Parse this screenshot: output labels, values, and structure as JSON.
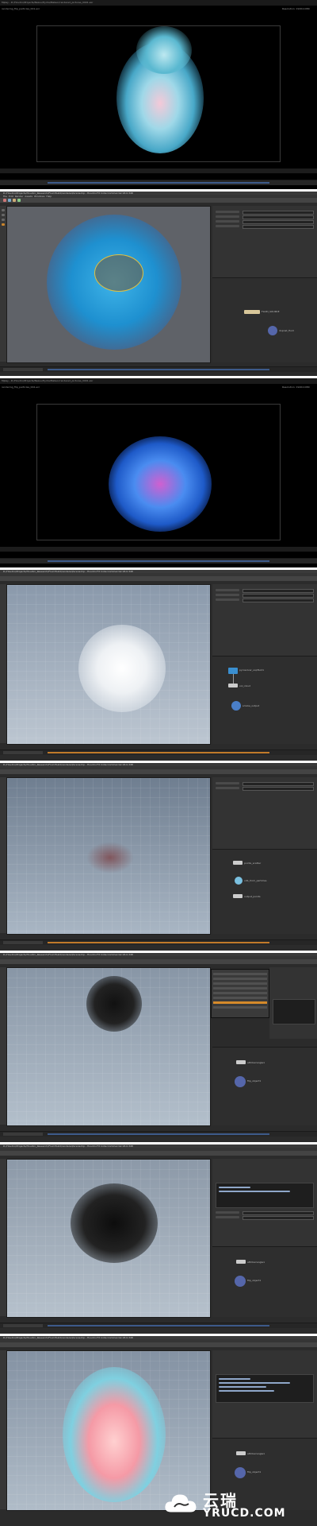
{
  "app": {
    "title_bar_text": "Mplay - D:/Houdini/Projects/Nexus/Hydra/Meteor/rendered_pictures_0001.exr",
    "menus": [
      "File",
      "Edit",
      "Render",
      "Assets",
      "Windows",
      "Help"
    ],
    "scene_title": "D:/Houdini/Projects/Houdini_Research/Fluid Build/rendered/scene.hip - Houdini FX Indie Commercial 18.0.348"
  },
  "render_views": [
    {
      "corner_left": "rendering_flip_particles_001.exr",
      "corner_right": "Resolution: 1920x1080",
      "palette": "cyan-pink"
    },
    {
      "corner_left": "rendering_flip_particles_002.exr",
      "corner_right": "Resolution: 1920x1080",
      "palette": "blue-magenta"
    }
  ],
  "scenes": [
    {
      "label": "viewport-fluid-wireframe",
      "node_labels": [
        "FLUID_SOURCE",
        "dopnet_fluid"
      ]
    },
    {
      "label": "viewport-smoke-white",
      "node_labels": [
        "pyrosolver_sopfluid1",
        "vol_cloud",
        "smoke_output"
      ]
    },
    {
      "label": "viewport-points-grid",
      "node_labels": [
        "points_scatter",
        "vdb_from_particles",
        "output_points"
      ]
    },
    {
      "label": "viewport-black-particles-menu",
      "node_labels": [
        "attribwrangle1",
        "flip_object1"
      ]
    },
    {
      "label": "viewport-black-particles-code",
      "node_labels": [
        "attribwrangle1",
        "flip_object1"
      ]
    },
    {
      "label": "viewport-colored-particles",
      "node_labels": [
        "attribwrangle1",
        "flip_object1"
      ]
    }
  ],
  "watermark": {
    "cn": "云瑞",
    "en": "YRUCD.COM"
  },
  "colors": {
    "ui_bg": "#2b2b2b",
    "accent_orange": "#d58a2a",
    "timeline_blue": "#3d5a8a"
  }
}
